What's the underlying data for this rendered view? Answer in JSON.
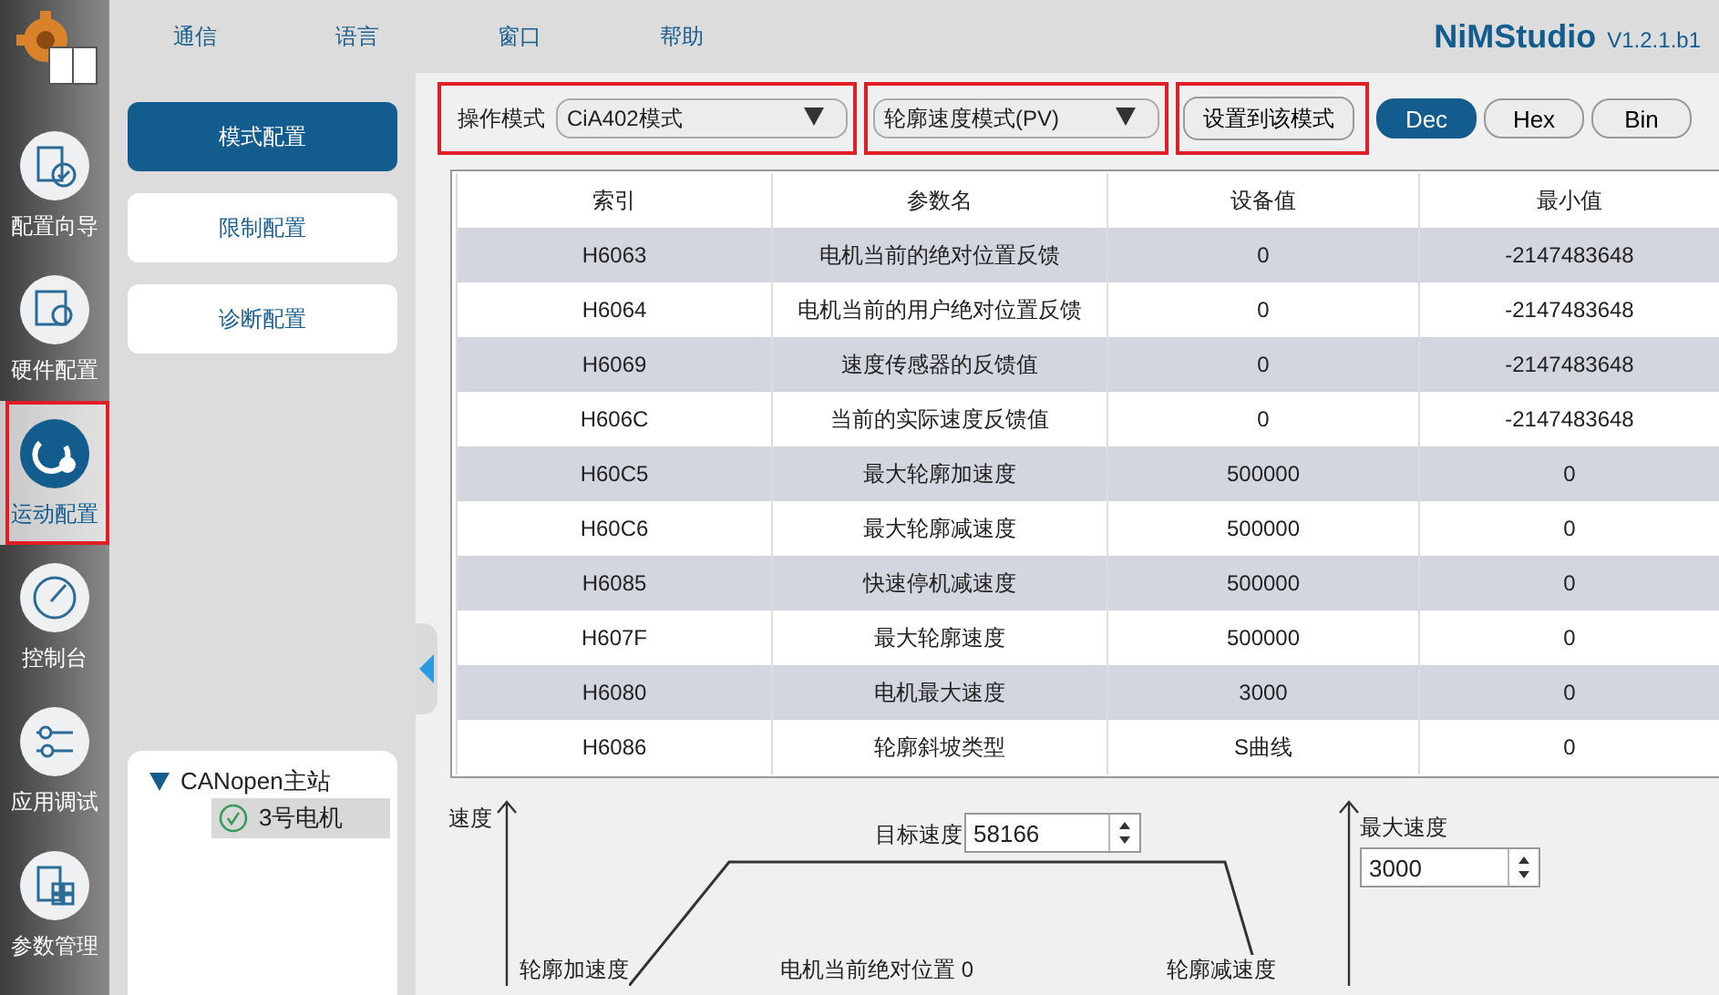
{
  "menu": [
    "通信",
    "语言",
    "窗口",
    "帮助"
  ],
  "app_title": "NiMStudio",
  "version": "V1.2.1.b1",
  "nav": [
    {
      "label": "配置向导",
      "selected": false,
      "highlighted": false
    },
    {
      "label": "硬件配置",
      "selected": false,
      "highlighted": false
    },
    {
      "label": "运动配置",
      "selected": true,
      "highlighted": true
    },
    {
      "label": "控制台",
      "selected": false,
      "highlighted": false
    },
    {
      "label": "应用调试",
      "selected": false,
      "highlighted": false
    },
    {
      "label": "参数管理",
      "selected": false,
      "highlighted": false
    }
  ],
  "subnav": [
    {
      "label": "模式配置",
      "selected": true
    },
    {
      "label": "限制配置",
      "selected": false
    },
    {
      "label": "诊断配置",
      "selected": false
    }
  ],
  "tree": {
    "label": "CANopen主站",
    "expanded": true,
    "children": [
      {
        "label": "3号电机",
        "selected": true
      }
    ]
  },
  "toolbar": {
    "mode": {
      "label": "操作模式",
      "value": "CiA402模式",
      "highlighted": true
    },
    "submode": {
      "value": "轮廓速度模式(PV)",
      "highlighted": true
    },
    "apply": {
      "label": "设置到该模式",
      "highlighted": true
    },
    "radix": [
      {
        "label": "Dec",
        "selected": true
      },
      {
        "label": "Hex",
        "selected": false
      },
      {
        "label": "Bin",
        "selected": false
      }
    ]
  },
  "table": {
    "columns": [
      "索引",
      "参数名",
      "设备值",
      "最小值"
    ],
    "rows": [
      [
        "H6063",
        "电机当前的绝对位置反馈",
        "0",
        "-2147483648"
      ],
      [
        "H6064",
        "电机当前的用户绝对位置反馈",
        "0",
        "-2147483648"
      ],
      [
        "H6069",
        "速度传感器的反馈值",
        "0",
        "-2147483648"
      ],
      [
        "H606C",
        "当前的实际速度反馈值",
        "0",
        "-2147483648"
      ],
      [
        "H60C5",
        "最大轮廓加速度",
        "500000",
        "0"
      ],
      [
        "H60C6",
        "最大轮廓减速度",
        "500000",
        "0"
      ],
      [
        "H6085",
        "快速停机减速度",
        "500000",
        "0"
      ],
      [
        "H607F",
        "最大轮廓速度",
        "500000",
        "0"
      ],
      [
        "H6080",
        "电机最大速度",
        "3000",
        "0"
      ],
      [
        "H6086",
        "轮廓斜坡类型",
        "S曲线",
        "0"
      ]
    ]
  },
  "diagram": {
    "axis_label": "速度",
    "target_label": "目标速度",
    "target_value": "58166",
    "max_label": "最大速度",
    "max_value": "3000",
    "accel_label": "轮廓加速度",
    "position_label": "电机当前绝对位置 0",
    "decel_label": "轮廓减速度"
  }
}
